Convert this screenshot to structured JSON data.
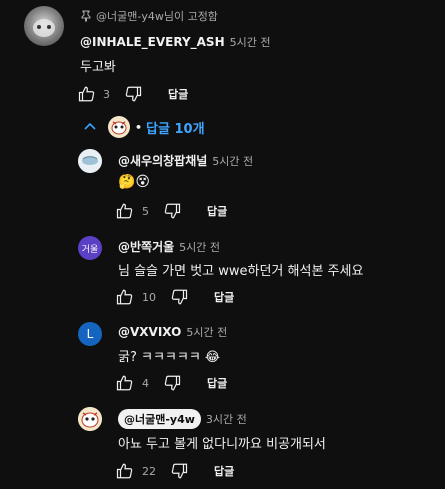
{
  "top_comment": {
    "pinned_label": "@너굴맨-y4w님이 고정함",
    "author": "@INHALE_EVERY_ASH",
    "time": "5시간 전",
    "text": "두고봐",
    "likes": "3",
    "reply_label": "답글"
  },
  "replies_toggle": {
    "label": "답글 10개",
    "separator": "•"
  },
  "replies": [
    {
      "author": "@새우의창팝채널",
      "time": "5시간 전",
      "text": "🤔😵",
      "likes": "5",
      "reply_label": "답글"
    },
    {
      "author": "@반쪽거울",
      "avatar_text": "거울",
      "time": "5시간 전",
      "text": "님 슬슬 가면 벗고 wwe하던거 해석본 주세요",
      "likes": "10",
      "reply_label": "답글"
    },
    {
      "author": "@VXVIXO",
      "avatar_text": "L",
      "time": "5시간 전",
      "text": "굵? ㅋㅋㅋㅋㅋ 😂",
      "likes": "4",
      "reply_label": "답글"
    },
    {
      "author": "@너굴맨-y4w",
      "time": "3시간 전",
      "text": "아뇨 두고 볼게 없다니까요 비공개되서",
      "likes": "22",
      "reply_label": "답글"
    }
  ],
  "colors": {
    "background": "#0f0f0f",
    "link_blue": "#3ea6ff",
    "secondary_text": "#aaaaaa",
    "avatar_purple": "#5b3fc4",
    "avatar_blue": "#1565c0"
  }
}
